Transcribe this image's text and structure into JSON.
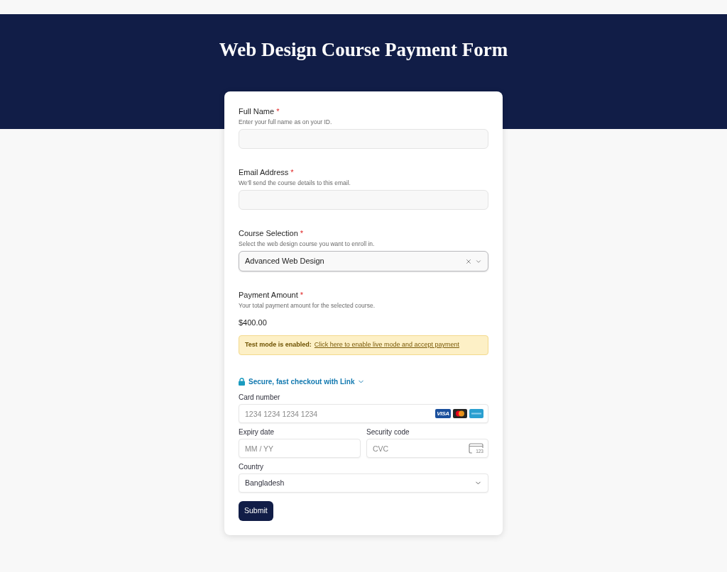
{
  "header": {
    "title": "Web Design Course Payment Form"
  },
  "fields": [
    {
      "kind": "text",
      "label": "Full Name",
      "required_mark": "*",
      "hint": "Enter your full name as on your ID."
    },
    {
      "kind": "text",
      "label": "Email Address",
      "required_mark": "*",
      "hint": "We'll send the course details to this email."
    },
    {
      "kind": "select",
      "label": "Course Selection",
      "required_mark": "*",
      "hint": "Select the web design course you want to enroll in.",
      "value": "Advanced Web Design"
    },
    {
      "kind": "amount",
      "label": "Payment Amount",
      "required_mark": "*",
      "hint": "Your total payment amount for the selected course.",
      "value": "$400.00"
    }
  ],
  "test_mode_notice": {
    "label": "Test mode is enabled:",
    "link": "Click here to enable live mode and accept payment"
  },
  "payment": {
    "link_checkout": "Secure, fast checkout with Link",
    "card_number": {
      "label": "Card number",
      "placeholder": "1234 1234 1234 1234",
      "brands": [
        {
          "kind": "visa",
          "label": "VISA"
        },
        {
          "kind": "mastercard"
        },
        {
          "kind": "amex"
        }
      ]
    },
    "expiry": {
      "label": "Expiry date",
      "placeholder": "MM / YY"
    },
    "security_code": {
      "label": "Security code",
      "placeholder": "CVC",
      "icon_text": "123"
    },
    "country": {
      "label": "Country",
      "value": "Bangladesh"
    }
  },
  "submit": {
    "label": "Submit"
  }
}
